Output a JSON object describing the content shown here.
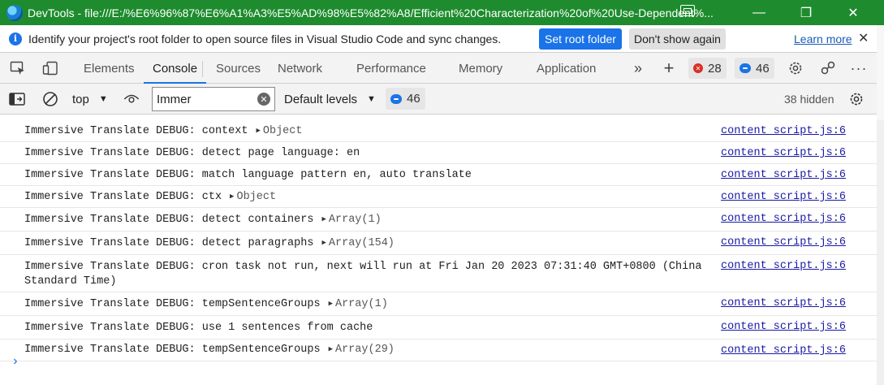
{
  "window": {
    "title": "DevTools - file:///E:/%E6%96%87%E6%A1%A3%E5%AD%98%E5%82%A8/Efficient%20Characterization%20of%20Use-Dependent%..."
  },
  "infobar": {
    "message": "Identify your project's root folder to open source files in Visual Studio Code and sync changes.",
    "set_root_label": "Set root folder",
    "dont_show_label": "Don't show again",
    "learn_more_label": "Learn more"
  },
  "tabs": [
    {
      "label": "Elements"
    },
    {
      "label": "Console"
    },
    {
      "label": "Sources"
    },
    {
      "label": "Network"
    },
    {
      "label": "Performance"
    },
    {
      "label": "Memory"
    },
    {
      "label": "Application"
    }
  ],
  "badges": {
    "errors": "28",
    "messages": "46"
  },
  "console_toolbar": {
    "context": "top",
    "filter_value": "Immer",
    "levels": "Default levels",
    "message_count": "46",
    "hidden": "38 hidden"
  },
  "messages": [
    {
      "text": "Immersive Translate DEBUG: context",
      "obj": "Object",
      "source": "content_script.js:6"
    },
    {
      "text": "Immersive Translate DEBUG: detect page language: en",
      "obj": "",
      "source": "content_script.js:6"
    },
    {
      "text": "Immersive Translate DEBUG: match language pattern en, auto translate",
      "obj": "",
      "source": "content_script.js:6"
    },
    {
      "text": "Immersive Translate DEBUG: ctx",
      "obj": "Object",
      "source": "content_script.js:6"
    },
    {
      "text": "Immersive Translate DEBUG: detect containers",
      "obj": "Array(1)",
      "source": "content_script.js:6"
    },
    {
      "text": "Immersive Translate DEBUG: detect paragraphs",
      "obj": "Array(154)",
      "source": "content_script.js:6"
    },
    {
      "text": "Immersive Translate DEBUG: cron task not run, next will run at Fri Jan 20 2023 07:31:40 GMT+0800 (China Standard Time)",
      "obj": "",
      "source": "content_script.js:6"
    },
    {
      "text": "Immersive Translate DEBUG: tempSentenceGroups",
      "obj": "Array(1)",
      "source": "content_script.js:6"
    },
    {
      "text": "Immersive Translate DEBUG: use 1 sentences from cache",
      "obj": "",
      "source": "content_script.js:6"
    },
    {
      "text": "Immersive Translate DEBUG: tempSentenceGroups",
      "obj": "Array(29)",
      "source": "content_script.js:6"
    }
  ],
  "prompt": "›"
}
